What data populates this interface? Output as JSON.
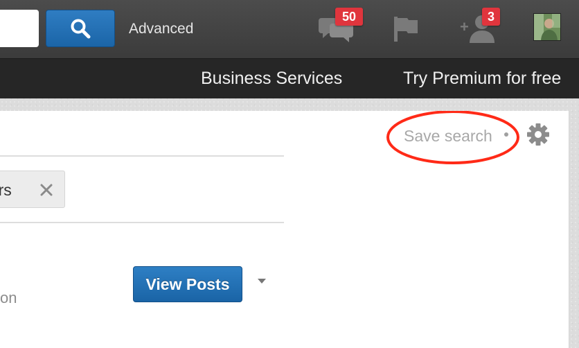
{
  "header": {
    "search_placeholder": "",
    "advanced_label": "Advanced",
    "messages_badge": "50",
    "connections_badge": "3"
  },
  "subnav": {
    "business_services": "Business Services",
    "try_premium": "Try Premium for free"
  },
  "panel": {
    "filter_pill_label": "bers",
    "save_search_label": "Save search",
    "view_posts_label": "View Posts",
    "partial_text": "on"
  },
  "colors": {
    "primary_blue": "#1f6fb5",
    "badge_red": "#e0353d",
    "annotation_red": "#ff2a17",
    "topbar": "#434343",
    "subnav": "#262626"
  },
  "icons": {
    "search": "search-icon",
    "messages": "messages-icon",
    "flag": "flag-icon",
    "connections": "add-connection-icon",
    "settings": "gear-icon",
    "close": "close-icon",
    "dropdown": "caret-down-icon"
  }
}
